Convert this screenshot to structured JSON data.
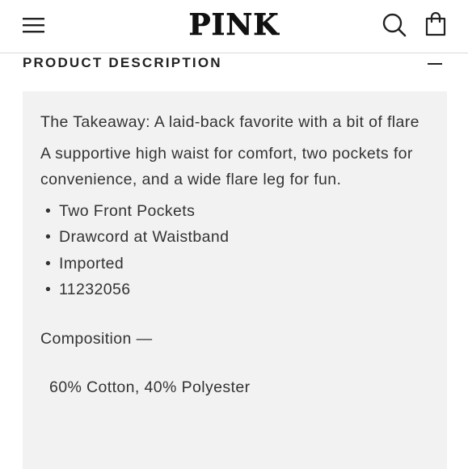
{
  "header": {
    "logo": "PINK",
    "menu_icon": "hamburger-menu-icon",
    "search_icon": "search-icon",
    "bag_icon": "shopping-bag-icon"
  },
  "section": {
    "title": "PRODUCT DESCRIPTION",
    "collapse_icon": "minus-icon"
  },
  "description": {
    "takeaway": "The Takeaway: A laid-back favorite with a bit of flare",
    "body": "A supportive high waist for comfort, two pockets for convenience, and a wide flare leg for fun.",
    "bullets": [
      "Two Front Pockets",
      "Drawcord at Waistband",
      "Imported",
      "11232056"
    ],
    "composition_label": "Composition —",
    "composition_value": "60% Cotton, 40% Polyester"
  },
  "colors": {
    "panel_background": "#f2f2f2",
    "text": "#333333",
    "divider": "#d9d9d9"
  }
}
